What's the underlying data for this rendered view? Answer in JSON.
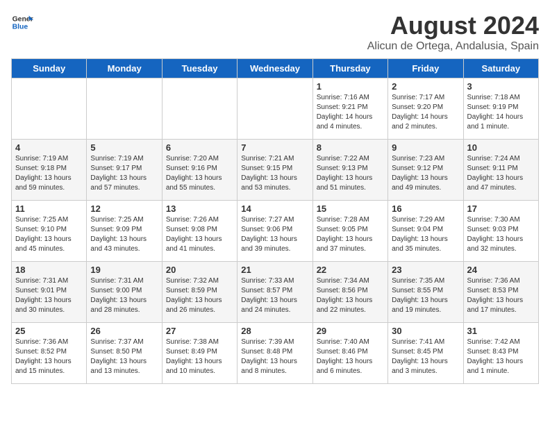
{
  "header": {
    "logo_general": "General",
    "logo_blue": "Blue",
    "main_title": "August 2024",
    "subtitle": "Alicun de Ortega, Andalusia, Spain"
  },
  "weekdays": [
    "Sunday",
    "Monday",
    "Tuesday",
    "Wednesday",
    "Thursday",
    "Friday",
    "Saturday"
  ],
  "weeks": [
    [
      {
        "day": "",
        "info": ""
      },
      {
        "day": "",
        "info": ""
      },
      {
        "day": "",
        "info": ""
      },
      {
        "day": "",
        "info": ""
      },
      {
        "day": "1",
        "info": "Sunrise: 7:16 AM\nSunset: 9:21 PM\nDaylight: 14 hours\nand 4 minutes."
      },
      {
        "day": "2",
        "info": "Sunrise: 7:17 AM\nSunset: 9:20 PM\nDaylight: 14 hours\nand 2 minutes."
      },
      {
        "day": "3",
        "info": "Sunrise: 7:18 AM\nSunset: 9:19 PM\nDaylight: 14 hours\nand 1 minute."
      }
    ],
    [
      {
        "day": "4",
        "info": "Sunrise: 7:19 AM\nSunset: 9:18 PM\nDaylight: 13 hours\nand 59 minutes."
      },
      {
        "day": "5",
        "info": "Sunrise: 7:19 AM\nSunset: 9:17 PM\nDaylight: 13 hours\nand 57 minutes."
      },
      {
        "day": "6",
        "info": "Sunrise: 7:20 AM\nSunset: 9:16 PM\nDaylight: 13 hours\nand 55 minutes."
      },
      {
        "day": "7",
        "info": "Sunrise: 7:21 AM\nSunset: 9:15 PM\nDaylight: 13 hours\nand 53 minutes."
      },
      {
        "day": "8",
        "info": "Sunrise: 7:22 AM\nSunset: 9:13 PM\nDaylight: 13 hours\nand 51 minutes."
      },
      {
        "day": "9",
        "info": "Sunrise: 7:23 AM\nSunset: 9:12 PM\nDaylight: 13 hours\nand 49 minutes."
      },
      {
        "day": "10",
        "info": "Sunrise: 7:24 AM\nSunset: 9:11 PM\nDaylight: 13 hours\nand 47 minutes."
      }
    ],
    [
      {
        "day": "11",
        "info": "Sunrise: 7:25 AM\nSunset: 9:10 PM\nDaylight: 13 hours\nand 45 minutes."
      },
      {
        "day": "12",
        "info": "Sunrise: 7:25 AM\nSunset: 9:09 PM\nDaylight: 13 hours\nand 43 minutes."
      },
      {
        "day": "13",
        "info": "Sunrise: 7:26 AM\nSunset: 9:08 PM\nDaylight: 13 hours\nand 41 minutes."
      },
      {
        "day": "14",
        "info": "Sunrise: 7:27 AM\nSunset: 9:06 PM\nDaylight: 13 hours\nand 39 minutes."
      },
      {
        "day": "15",
        "info": "Sunrise: 7:28 AM\nSunset: 9:05 PM\nDaylight: 13 hours\nand 37 minutes."
      },
      {
        "day": "16",
        "info": "Sunrise: 7:29 AM\nSunset: 9:04 PM\nDaylight: 13 hours\nand 35 minutes."
      },
      {
        "day": "17",
        "info": "Sunrise: 7:30 AM\nSunset: 9:03 PM\nDaylight: 13 hours\nand 32 minutes."
      }
    ],
    [
      {
        "day": "18",
        "info": "Sunrise: 7:31 AM\nSunset: 9:01 PM\nDaylight: 13 hours\nand 30 minutes."
      },
      {
        "day": "19",
        "info": "Sunrise: 7:31 AM\nSunset: 9:00 PM\nDaylight: 13 hours\nand 28 minutes."
      },
      {
        "day": "20",
        "info": "Sunrise: 7:32 AM\nSunset: 8:59 PM\nDaylight: 13 hours\nand 26 minutes."
      },
      {
        "day": "21",
        "info": "Sunrise: 7:33 AM\nSunset: 8:57 PM\nDaylight: 13 hours\nand 24 minutes."
      },
      {
        "day": "22",
        "info": "Sunrise: 7:34 AM\nSunset: 8:56 PM\nDaylight: 13 hours\nand 22 minutes."
      },
      {
        "day": "23",
        "info": "Sunrise: 7:35 AM\nSunset: 8:55 PM\nDaylight: 13 hours\nand 19 minutes."
      },
      {
        "day": "24",
        "info": "Sunrise: 7:36 AM\nSunset: 8:53 PM\nDaylight: 13 hours\nand 17 minutes."
      }
    ],
    [
      {
        "day": "25",
        "info": "Sunrise: 7:36 AM\nSunset: 8:52 PM\nDaylight: 13 hours\nand 15 minutes."
      },
      {
        "day": "26",
        "info": "Sunrise: 7:37 AM\nSunset: 8:50 PM\nDaylight: 13 hours\nand 13 minutes."
      },
      {
        "day": "27",
        "info": "Sunrise: 7:38 AM\nSunset: 8:49 PM\nDaylight: 13 hours\nand 10 minutes."
      },
      {
        "day": "28",
        "info": "Sunrise: 7:39 AM\nSunset: 8:48 PM\nDaylight: 13 hours\nand 8 minutes."
      },
      {
        "day": "29",
        "info": "Sunrise: 7:40 AM\nSunset: 8:46 PM\nDaylight: 13 hours\nand 6 minutes."
      },
      {
        "day": "30",
        "info": "Sunrise: 7:41 AM\nSunset: 8:45 PM\nDaylight: 13 hours\nand 3 minutes."
      },
      {
        "day": "31",
        "info": "Sunrise: 7:42 AM\nSunset: 8:43 PM\nDaylight: 13 hours\nand 1 minute."
      }
    ]
  ]
}
